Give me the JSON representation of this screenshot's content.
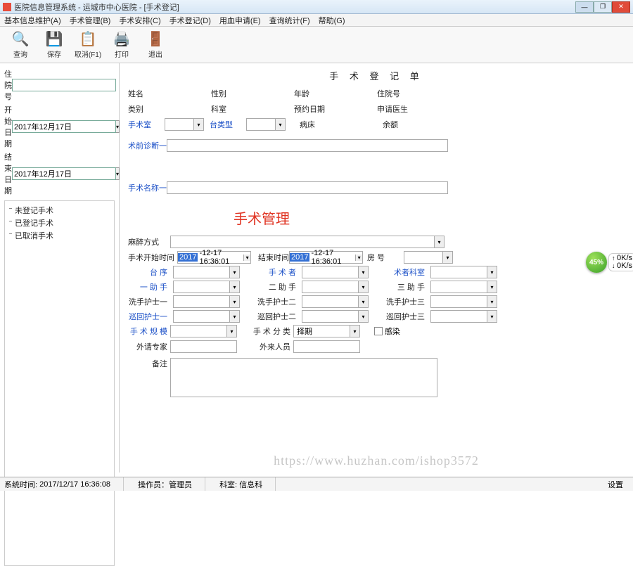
{
  "title": "医院信息管理系统  -   运城市中心医院 - [手术登记]",
  "window_buttons": {
    "min": "—",
    "max": "❐",
    "close": "✕"
  },
  "menu": [
    "基本信息维护(A)",
    "手术管理(B)",
    "手术安排(C)",
    "手术登记(D)",
    "用血申请(E)",
    "查询统计(F)",
    "帮助(G)"
  ],
  "toolbar": [
    {
      "icon": "🔍",
      "label": "查询",
      "name": "search"
    },
    {
      "icon": "💾",
      "label": "保存",
      "name": "save"
    },
    {
      "icon": "📋",
      "label": "取消(F1)",
      "name": "cancel"
    },
    {
      "icon": "🖨️",
      "label": "打印",
      "name": "print"
    },
    {
      "icon": "🚪",
      "label": "退出",
      "name": "exit"
    }
  ],
  "sidebar": {
    "fields": {
      "hospno": "住院号",
      "start": "开始日期",
      "end": "结束日期"
    },
    "start_val": "2017年12月17日",
    "end_val": "2017年12月17日",
    "tree": [
      "未登记手术",
      "已登记手术",
      "已取消手术"
    ]
  },
  "form": {
    "title": "手 术 登 记 单",
    "r1": {
      "name": "姓名",
      "sex": "性别",
      "age": "年龄",
      "hospno": "住院号"
    },
    "r2": {
      "cat": "类别",
      "dept": "科室",
      "date": "预约日期",
      "doc": "申请医生"
    },
    "r3": {
      "room": "手术室",
      "tabletype": "台类型",
      "bed": "病床",
      "bal": "余额"
    },
    "preop": "术前诊断一",
    "opname": "手术名称一",
    "section": "手术管理",
    "anest": "麻醉方式",
    "start": "手术开始时间",
    "end": "结束时间",
    "roomno": "房    号",
    "dt_val_hl": "2017",
    "dt_val_rest": "-12-17 16:36:01",
    "tai": "台    序",
    "surgeon": "手 术 者",
    "surgdept": "术者科室",
    "a1": "一 助 手",
    "a2": "二 助 手",
    "a3": "三 助 手",
    "n1": "洗手护士一",
    "n2": "洗手护士二",
    "n3": "洗手护士三",
    "c1": "巡回护士一",
    "c2": "巡回护士二",
    "c3": "巡回护士三",
    "scale": "手 术 规 模",
    "class": "手 术 分 类",
    "class_val": "择期",
    "infect": "感染",
    "expert": "外请专家",
    "extern": "外来人员",
    "remark": "备注"
  },
  "badge": {
    "pct": "45%",
    "up": "0K/s",
    "dn": "0K/s"
  },
  "watermark": "https://www.huzhan.com/ishop3572",
  "status": {
    "time_lbl": "系统时间:",
    "time": "2017/12/17 16:36:08",
    "op_lbl": "操作员：",
    "op": "管理员",
    "dept_lbl": "科室:",
    "dept": "信息科",
    "set": "设置"
  }
}
